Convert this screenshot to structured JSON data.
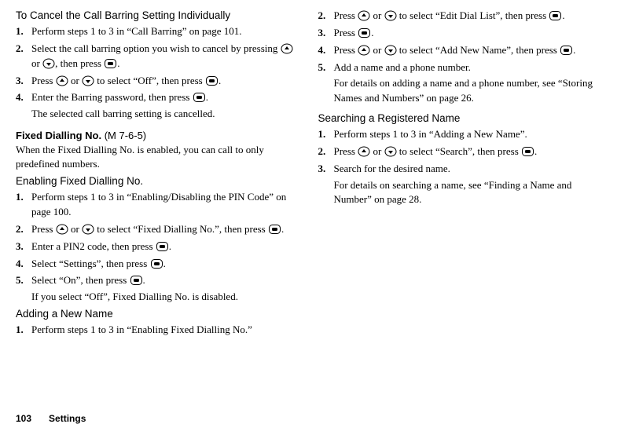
{
  "footer": {
    "page_number": "103",
    "label": "Settings"
  },
  "left": {
    "h1": "To Cancel the Call Barring Setting Individually",
    "s1_steps": {
      "n1": "1.",
      "t1": "Perform steps 1 to 3 in “Call Barring” on page 101.",
      "n2": "2.",
      "t2a": "Select the call barring option you wish to cancel by pressing ",
      "t2b": " or ",
      "t2c": ", then press ",
      "t2d": ".",
      "n3": "3.",
      "t3a": "Press ",
      "t3b": " or ",
      "t3c": " to select “Off”, then press ",
      "t3d": ".",
      "n4": "4.",
      "t4a": "Enter the Barring password, then press ",
      "t4b": ".",
      "t4sub": "The selected call barring setting is cancelled."
    },
    "h2a": "Fixed Dialling No. ",
    "h2b": "(M 7-6-5)",
    "p2": "When the Fixed Dialling No. is enabled, you can call to only predefined numbers.",
    "h3": "Enabling Fixed Dialling No.",
    "s3_steps": {
      "n1": "1.",
      "t1": "Perform steps 1 to 3 in “Enabling/Disabling the PIN Code” on page 100.",
      "n2": "2.",
      "t2a": "Press ",
      "t2b": " or ",
      "t2c": " to select “Fixed Dialling No.”, then press ",
      "t2d": ".",
      "n3": "3.",
      "t3a": "Enter a PIN2 code, then press ",
      "t3b": ".",
      "n4": "4.",
      "t4a": "Select “Settings”, then press ",
      "t4b": ".",
      "n5": "5.",
      "t5a": "Select “On”, then press ",
      "t5b": ".",
      "t5sub": "If you select “Off”, Fixed Dialling No. is disabled."
    },
    "h4": "Adding a New Name",
    "s4_steps": {
      "n1": "1.",
      "t1": "Perform steps 1 to 3 in “Enabling Fixed Dialling No.”"
    }
  },
  "right": {
    "s4b_steps": {
      "n2": "2.",
      "t2a": "Press ",
      "t2b": " or ",
      "t2c": " to select “Edit Dial List”, then press ",
      "t2d": ".",
      "n3": "3.",
      "t3a": "Press ",
      "t3b": ".",
      "n4": "4.",
      "t4a": "Press ",
      "t4b": " or ",
      "t4c": " to select “Add New Name”, then press ",
      "t4d": ".",
      "n5": "5.",
      "t5a": "Add a name and a phone number.",
      "t5sub": "For details on adding a name and a phone number, see “Storing Names and Numbers” on page 26."
    },
    "h5": "Searching a Registered Name",
    "s5_steps": {
      "n1": "1.",
      "t1": "Perform steps 1 to 3 in “Adding a New Name”.",
      "n2": "2.",
      "t2a": "Press ",
      "t2b": " or ",
      "t2c": " to select “Search”, then press ",
      "t2d": ".",
      "n3": "3.",
      "t3a": "Search for the desired name.",
      "t3sub": "For details on searching a name, see “Finding a Name and Number” on page 28."
    }
  }
}
